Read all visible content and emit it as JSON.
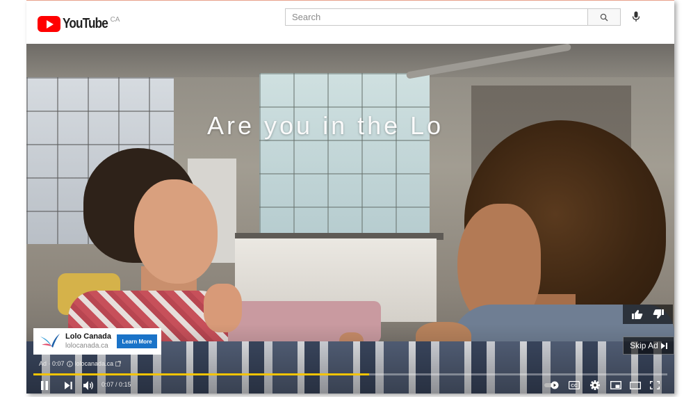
{
  "header": {
    "logo_text": "YouTube",
    "country": "CA",
    "search_placeholder": "Search",
    "search_icon": "search-icon",
    "mic_icon": "mic-icon"
  },
  "video": {
    "caption": "Are you in the Lo",
    "ad_card": {
      "advertiser": "Lolo Canada",
      "domain": "lolocanada.ca",
      "cta": "Learn More"
    },
    "ad_info": {
      "label": "Ad · 0:07",
      "info_icon": "info-icon",
      "domain": "lolocanada.ca",
      "external_icon": "external-link-icon"
    },
    "skip_label": "Skip Ad",
    "progress_fraction": 0.53,
    "time": "0:07 / 0:15",
    "colors": {
      "progress": "#f4c400",
      "cta": "#1a73c8",
      "logo_red": "#ff0000"
    }
  },
  "controls": {
    "left": [
      "pause-icon",
      "next-icon",
      "volume-icon"
    ],
    "right": [
      "autoplay-toggle-icon",
      "captions-icon",
      "settings-icon",
      "miniplayer-icon",
      "theater-icon",
      "fullscreen-icon"
    ]
  }
}
